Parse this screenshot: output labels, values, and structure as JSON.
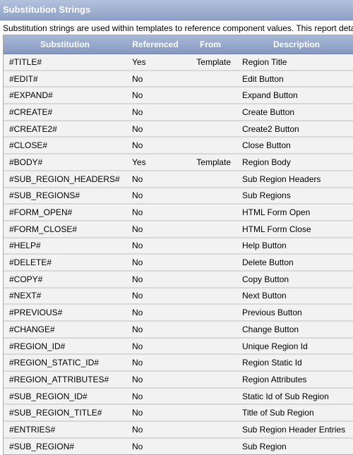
{
  "region": {
    "title": "Substitution Strings",
    "description": "Substitution strings are used within templates to reference component values. This report details"
  },
  "table": {
    "headers": {
      "substitution": "Substitution",
      "referenced": "Referenced",
      "from": "From",
      "description": "Description"
    },
    "rows": [
      {
        "substitution": "#TITLE#",
        "referenced": "Yes",
        "from": "Template",
        "description": "Region Title"
      },
      {
        "substitution": "#EDIT#",
        "referenced": "No",
        "from": "",
        "description": "Edit Button"
      },
      {
        "substitution": "#EXPAND#",
        "referenced": "No",
        "from": "",
        "description": "Expand Button"
      },
      {
        "substitution": "#CREATE#",
        "referenced": "No",
        "from": "",
        "description": "Create Button"
      },
      {
        "substitution": "#CREATE2#",
        "referenced": "No",
        "from": "",
        "description": "Create2 Button"
      },
      {
        "substitution": "#CLOSE#",
        "referenced": "No",
        "from": "",
        "description": "Close Button"
      },
      {
        "substitution": "#BODY#",
        "referenced": "Yes",
        "from": "Template",
        "description": "Region Body"
      },
      {
        "substitution": "#SUB_REGION_HEADERS#",
        "referenced": "No",
        "from": "",
        "description": "Sub Region Headers"
      },
      {
        "substitution": "#SUB_REGIONS#",
        "referenced": "No",
        "from": "",
        "description": "Sub Regions"
      },
      {
        "substitution": "#FORM_OPEN#",
        "referenced": "No",
        "from": "",
        "description": "HTML Form Open"
      },
      {
        "substitution": "#FORM_CLOSE#",
        "referenced": "No",
        "from": "",
        "description": "HTML Form Close"
      },
      {
        "substitution": "#HELP#",
        "referenced": "No",
        "from": "",
        "description": "Help Button"
      },
      {
        "substitution": "#DELETE#",
        "referenced": "No",
        "from": "",
        "description": "Delete Button"
      },
      {
        "substitution": "#COPY#",
        "referenced": "No",
        "from": "",
        "description": "Copy Button"
      },
      {
        "substitution": "#NEXT#",
        "referenced": "No",
        "from": "",
        "description": "Next Button"
      },
      {
        "substitution": "#PREVIOUS#",
        "referenced": "No",
        "from": "",
        "description": "Previous Button"
      },
      {
        "substitution": "#CHANGE#",
        "referenced": "No",
        "from": "",
        "description": "Change Button"
      },
      {
        "substitution": "#REGION_ID#",
        "referenced": "No",
        "from": "",
        "description": "Unique Region Id"
      },
      {
        "substitution": "#REGION_STATIC_ID#",
        "referenced": "No",
        "from": "",
        "description": "Region Static Id"
      },
      {
        "substitution": "#REGION_ATTRIBUTES#",
        "referenced": "No",
        "from": "",
        "description": "Region Attributes"
      },
      {
        "substitution": "#SUB_REGION_ID#",
        "referenced": "No",
        "from": "",
        "description": "Static Id of Sub Region"
      },
      {
        "substitution": "#SUB_REGION_TITLE#",
        "referenced": "No",
        "from": "",
        "description": "Title of Sub Region"
      },
      {
        "substitution": "#ENTRIES#",
        "referenced": "No",
        "from": "",
        "description": "Sub Region Header Entries"
      },
      {
        "substitution": "#SUB_REGION#",
        "referenced": "No",
        "from": "",
        "description": "Sub Region"
      }
    ]
  }
}
